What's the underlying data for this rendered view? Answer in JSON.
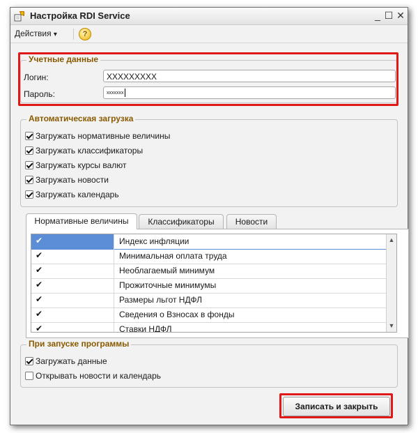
{
  "window": {
    "title": "Настройка RDI Service",
    "controls": [
      "_",
      "☐",
      "✕"
    ]
  },
  "toolbar": {
    "actions_label": "Действия",
    "actions_arrow": "▾",
    "help_label": "?"
  },
  "credentials": {
    "title": "Учетные данные",
    "login_label": "Логин:",
    "login_value": "XXXXXXXXX",
    "password_label": "Пароль:",
    "password_value": "xxxxxxx"
  },
  "autoload": {
    "title": "Автоматическая загрузка",
    "items": [
      {
        "label": "Загружать нормативные величины",
        "checked": true
      },
      {
        "label": "Загружать классификаторы",
        "checked": true
      },
      {
        "label": "Загружать курсы валют",
        "checked": true
      },
      {
        "label": "Загружать новости",
        "checked": true
      },
      {
        "label": "Загружать календарь",
        "checked": true
      }
    ]
  },
  "tabs": [
    {
      "label": "Нормативные величины",
      "active": true
    },
    {
      "label": "Классификаторы",
      "active": false
    },
    {
      "label": "Новости",
      "active": false
    }
  ],
  "table": {
    "check_mark": "✔",
    "rows": [
      {
        "name": "Индекс инфляции",
        "checked": true,
        "selected": true
      },
      {
        "name": "Минимальная оплата труда",
        "checked": true,
        "selected": false
      },
      {
        "name": "Необлагаемый минимум",
        "checked": true,
        "selected": false
      },
      {
        "name": "Прожиточные минимумы",
        "checked": true,
        "selected": false
      },
      {
        "name": "Размеры льгот НДФЛ",
        "checked": true,
        "selected": false
      },
      {
        "name": "Сведения о Взносах в фонды",
        "checked": true,
        "selected": false
      },
      {
        "name": "Ставки НДФЛ",
        "checked": true,
        "selected": false
      }
    ],
    "scroll_up": "▲",
    "scroll_down": "▼"
  },
  "startup": {
    "title": "При запуске программы",
    "items": [
      {
        "label": "Загружать данные",
        "checked": true
      },
      {
        "label": "Открывать новости и календарь",
        "checked": false
      }
    ]
  },
  "footer": {
    "save_label": "Записать и закрыть"
  },
  "colors": {
    "highlight": "#e01818",
    "group_title": "#8a5a00",
    "selection": "#5b8ed6"
  }
}
